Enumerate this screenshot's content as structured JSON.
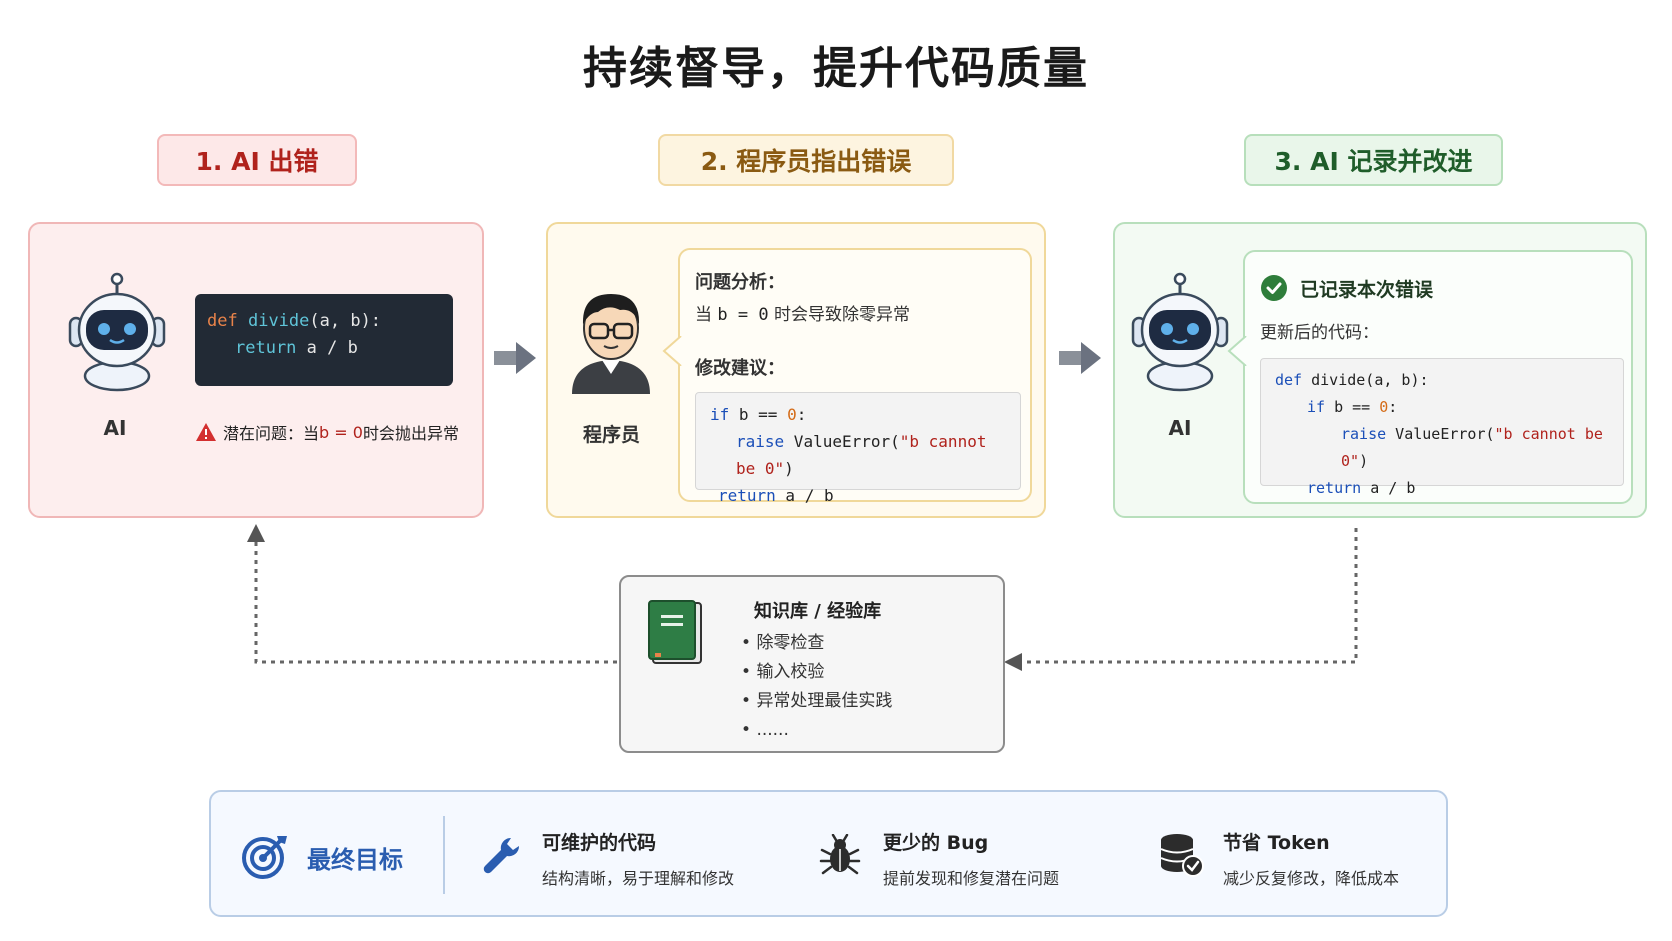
{
  "title": "持续督导，提升代码质量",
  "steps": [
    {
      "label": "1. AI 出错"
    },
    {
      "label": "2. 程序员指出错误"
    },
    {
      "label": "3. AI 记录并改进"
    }
  ],
  "panel1": {
    "ai_label": "AI",
    "code": {
      "line1": {
        "kw": "def",
        "fn": "divide",
        "rest": "(a, b):"
      },
      "line2": {
        "kw": "return",
        "rest": " a / b"
      }
    },
    "warning_prefix": "潜在问题：当 ",
    "warning_expr": "b = 0",
    "warning_suffix": " 时会抛出异常"
  },
  "panel2": {
    "programmer_label": "程序员",
    "analysis_title": "问题分析：",
    "analysis_prefix": "当 ",
    "analysis_expr": "b = 0",
    "analysis_suffix": " 时会导致除零异常",
    "suggestion_title": "修改建议：",
    "code": {
      "l1_kw": "if",
      "l1_mid": " b == ",
      "l1_num": "0",
      "l1_end": ":",
      "l2_kw": "raise",
      "l2_mid": " ValueError(",
      "l2_str": "\"b cannot be 0\"",
      "l2_end": ")",
      "l3_kw": "return",
      "l3_rest": " a / b"
    }
  },
  "panel3": {
    "ai_label": "AI",
    "recorded_title": "已记录本次错误",
    "updated_label": "更新后的代码：",
    "code": {
      "l1_kw": "def",
      "l1_rest": " divide(a, b):",
      "l2_kw": "if",
      "l2_mid": " b == ",
      "l2_num": "0",
      "l2_end": ":",
      "l3_kw": "raise",
      "l3_mid": " ValueError(",
      "l3_str": "\"b cannot be 0\"",
      "l3_end": ")",
      "l4_kw": "return",
      "l4_rest": " a / b"
    }
  },
  "knowledge_base": {
    "title": "知识库 / 经验库",
    "items": [
      "除零检查",
      "输入校验",
      "异常处理最佳实践",
      "......"
    ]
  },
  "goals": {
    "title": "最终目标",
    "features": [
      {
        "title": "可维护的代码",
        "desc": "结构清晰，易于理解和修改",
        "icon": "wrench-icon"
      },
      {
        "title": "更少的 Bug",
        "desc": "提前发现和修复潜在问题",
        "icon": "bug-icon"
      },
      {
        "title": "节省 Token",
        "desc": "减少反复修改，降低成本",
        "icon": "database-check-icon"
      }
    ]
  },
  "colors": {
    "error_red": "#b0221c",
    "warn_brown": "#8a5a12",
    "success_green": "#1f5d2a",
    "goal_blue": "#2a5db0"
  }
}
